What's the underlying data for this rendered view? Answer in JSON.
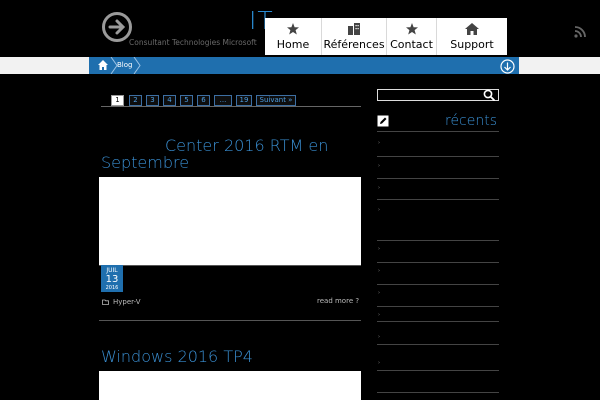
{
  "header": {
    "logo_letters": "IT",
    "tagline": "Consultant Technologies Microsoft",
    "logo_icon": "arrow-right-circle-icon",
    "rss_icon": "rss-icon"
  },
  "nav": {
    "items": [
      {
        "label": "Home",
        "icon": "star-icon"
      },
      {
        "label": "Références",
        "icon": "buildings-icon"
      },
      {
        "label": "Contact",
        "icon": "star-icon"
      },
      {
        "label": "Support",
        "icon": "house-icon"
      }
    ]
  },
  "breadcrumb": {
    "home_icon": "home-icon",
    "current": "Blog"
  },
  "pagination": {
    "pages": [
      "1",
      "2",
      "3",
      "4",
      "5",
      "6",
      "...",
      "19"
    ],
    "current": "1",
    "next_label": "Suivant »"
  },
  "posts": [
    {
      "title_line1": "Center 2016 RTM en",
      "title_line2": "Septembre",
      "date_month": "JUIL",
      "date_day": "13",
      "date_year": "2016",
      "category": "Hyper-V",
      "read_more": "read more ?"
    },
    {
      "title_line1": "Windows 2016 TP4"
    }
  ],
  "sidebar": {
    "search_placeholder": "",
    "recent_title": "récents",
    "recent_items": [
      "›",
      "›",
      "›",
      "›",
      "›",
      "›",
      "›",
      "›",
      "›",
      "›"
    ]
  },
  "colors": {
    "accent": "#3a8fd2",
    "bar_blue": "#1f6fae",
    "background": "#000000"
  }
}
